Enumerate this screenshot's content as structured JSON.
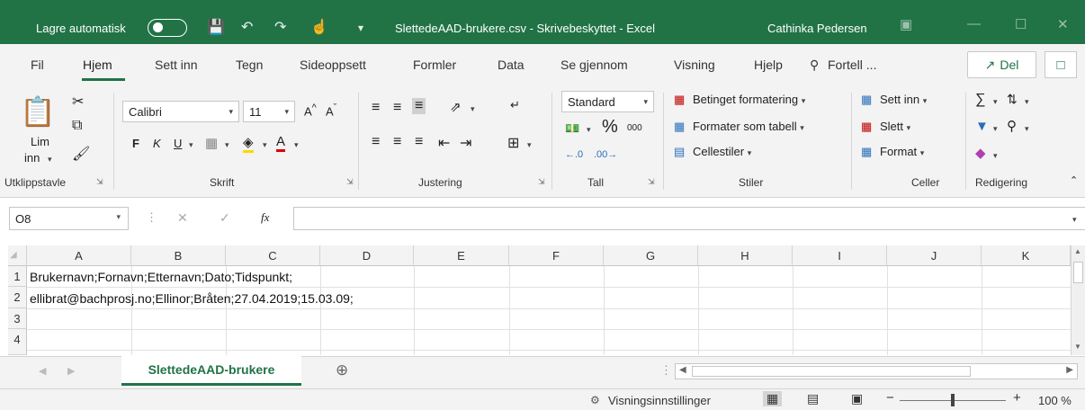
{
  "titlebar": {
    "autosave_label": "Lagre automatisk",
    "doc_title": "SlettedeAAD-brukere.csv  -  Skrivebeskyttet  -  Excel",
    "user_name": "Cathinka Pedersen"
  },
  "tabs": [
    "Fil",
    "Hjem",
    "Sett inn",
    "Tegn",
    "Sideoppsett",
    "Formler",
    "Data",
    "Se gjennom",
    "Visning",
    "Hjelp"
  ],
  "tell_me": "Fortell ...",
  "share_label": "Del",
  "ribbon": {
    "paste_label_1": "Lim",
    "paste_label_2": "inn",
    "font_name": "Calibri",
    "font_size": "11",
    "bold": "F",
    "italic": "K",
    "underline": "U",
    "number_format": "Standard",
    "percent": "%",
    "thousands": "000",
    "cond_format": "Betinget formatering",
    "format_table": "Formater som tabell",
    "cell_styles": "Cellestiler",
    "insert": "Sett inn",
    "delete": "Slett",
    "format": "Format",
    "groups": [
      "Utklippstavle",
      "Skrift",
      "Justering",
      "Tall",
      "Stiler",
      "Celler",
      "Redigering"
    ]
  },
  "formula_bar": {
    "name_box": "O8",
    "fx": "fx",
    "value": ""
  },
  "grid": {
    "columns": [
      "A",
      "B",
      "C",
      "D",
      "E",
      "F",
      "G",
      "H",
      "I",
      "J",
      "K"
    ],
    "rows": [
      "1",
      "2",
      "3",
      "4"
    ],
    "cells": {
      "A1": "Brukernavn;Fornavn;Etternavn;Dato;Tidspunkt;",
      "A2": "ellibrat@bachprosj.no;Ellinor;Bråten;27.04.2019;15.03.09;"
    }
  },
  "sheet_tab": "SlettedeAAD-brukere",
  "status": {
    "view_settings": "Visningsinnstillinger",
    "zoom": "100 %"
  },
  "colors": {
    "brand": "#217346",
    "ribbon_bg": "#f3f3f3"
  }
}
